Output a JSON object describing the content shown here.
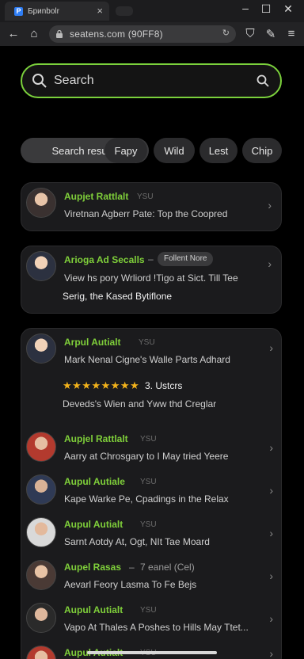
{
  "browser": {
    "tab_title": "Бриnbolr",
    "url": "seatens.com (90FF8)",
    "tab_close": "×",
    "favicon_letter": "P"
  },
  "search": {
    "placeholder": "Search"
  },
  "chips": [
    {
      "label": "Search results",
      "active": true
    },
    {
      "label": "Fapy",
      "active": false
    },
    {
      "label": "Wild",
      "active": false
    },
    {
      "label": "Lest",
      "active": false
    },
    {
      "label": "Chip",
      "active": false
    }
  ],
  "card1": {
    "name": "Aupjet Rattlalt",
    "meta": "YSU",
    "desc": "Viretnan Agberr Pate: Top the Coopred"
  },
  "card2": {
    "name": "Arioga Ad Secalls",
    "badge": "Follent Nore",
    "desc1": "View hs pory Wrliord !Tigo at Sict. Till Tee",
    "desc2": "Serig, the Kased Bytiflone"
  },
  "card3": {
    "top": {
      "name": "Arpul Autialt",
      "meta": "YSU",
      "desc": "Mark Nenal Cigne's Walle Parts Adhard",
      "stars": "★★★★★★★★",
      "users": "3. Ustcrs",
      "desc2": "Deveds's Wien and Yww thd Creglar"
    },
    "rows": [
      {
        "name": "Aupjel Rattlalt",
        "meta": "YSU",
        "desc": "Aarry at Chrosgary to I May tried Yeere"
      },
      {
        "name": "Aupul Autiale",
        "meta": "YSU",
        "desc": "Kape Warke Pe, Cpadings in the Relax"
      },
      {
        "name": "Aupul Autialt",
        "meta": "YSU",
        "desc": "Sarnt Aotdy At, Ogt, NIt Tae Moard"
      },
      {
        "name": "Aupel Rasas",
        "meta": "7 eanel (Cel)",
        "desc": "Aevarl Feory Lasma To Fe Bejs"
      },
      {
        "name": "Aupul Autialt",
        "meta": "YSU",
        "desc": "Vapo At Thales A Poshes to Hills May Ttet..."
      },
      {
        "name": "Aupul Autialt",
        "meta": "YSU",
        "desc": ""
      }
    ]
  },
  "colors": {
    "accent_green": "#7bd13c",
    "star_gold": "#f2b21b"
  }
}
